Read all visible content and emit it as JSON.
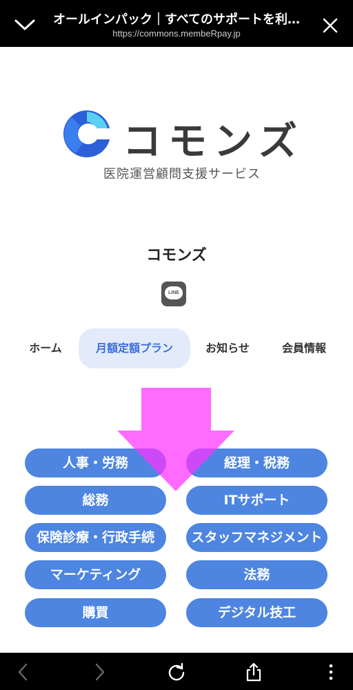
{
  "browser": {
    "title": "オールインパック｜すべてのサポートを利…",
    "url": "https://commons.membeRpay.jp"
  },
  "logo": {
    "brand": "コモンズ",
    "tagline": "医院運営顧問支援サービス",
    "colors": {
      "primary": "#3b7ef0",
      "accent": "#2d5fd6",
      "light": "#5ad0f5"
    }
  },
  "site_name": "コモンズ",
  "line_icon": {
    "label": "LINE"
  },
  "nav": {
    "tabs": [
      {
        "label": "ホーム"
      },
      {
        "label": "月額定額プラン",
        "active": true
      },
      {
        "label": "お知らせ"
      },
      {
        "label": "会員情報"
      }
    ]
  },
  "categories": [
    {
      "label": "人事・労務"
    },
    {
      "label": "経理・税務"
    },
    {
      "label": "総務"
    },
    {
      "label": "ITサポート"
    },
    {
      "label": "保険診療・行政手続"
    },
    {
      "label": "スタッフマネジメント"
    },
    {
      "label": "マーケティング"
    },
    {
      "label": "法務"
    },
    {
      "label": "購買"
    },
    {
      "label": "デジタル技工"
    }
  ],
  "icons": {
    "top_left": "chevron-down-icon",
    "top_right": "close-icon",
    "bottom": [
      "back-icon",
      "forward-icon",
      "reload-icon",
      "share-icon",
      "more-icon"
    ]
  },
  "colors": {
    "button": "#4d85e0",
    "active_tab_bg": "#e3ebfb",
    "active_tab_text": "#3b6fd8",
    "arrow": "#ff33ff"
  }
}
